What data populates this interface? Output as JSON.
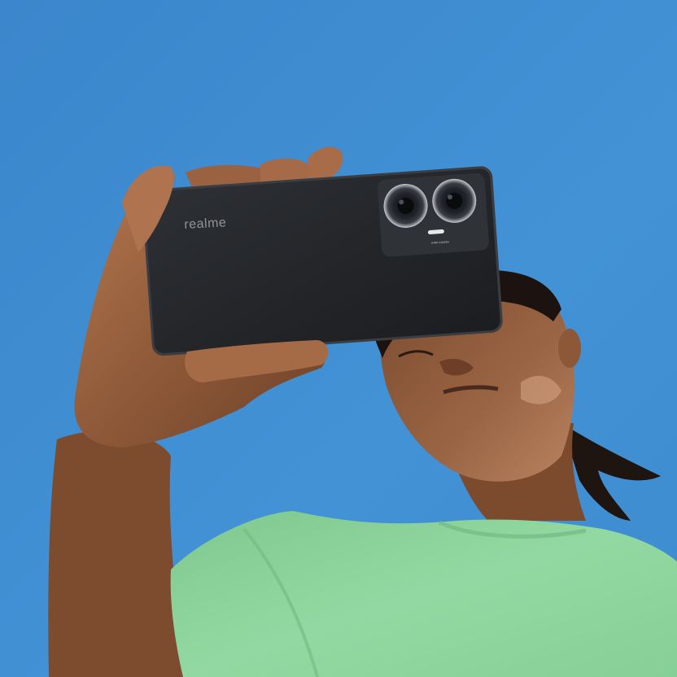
{
  "image": {
    "sky_color": "#3f8fd2",
    "shirt_color": "#8fd59e",
    "phone_color": "#26282c",
    "skin_color": "#8a5636"
  },
  "phone": {
    "brand": "realme",
    "module_label": "64MP CAMERA"
  }
}
